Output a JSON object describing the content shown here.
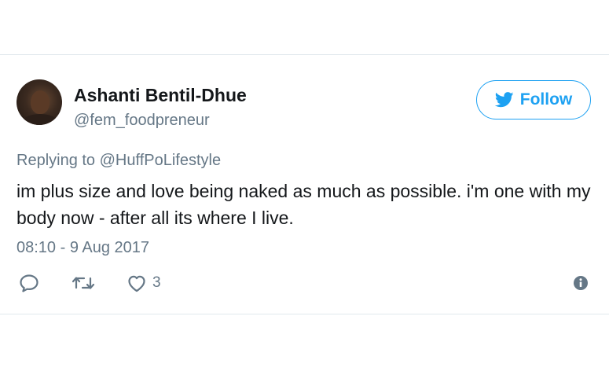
{
  "tweet": {
    "display_name": "Ashanti Bentil-Dhue",
    "handle": "@fem_foodpreneur",
    "replying_prefix": "Replying to",
    "replying_to": "@HuffPoLifestyle",
    "text": "im plus size and love being naked as much as possible. i'm one with my body now - after all its where I live.",
    "timestamp": "08:10 - 9 Aug 2017"
  },
  "follow_button": {
    "label": "Follow"
  },
  "actions": {
    "like_count": "3"
  },
  "icons": {
    "follow": "twitter-bird-icon",
    "reply": "reply-icon",
    "retweet": "retweet-icon",
    "like": "heart-icon",
    "info": "info-icon"
  },
  "colors": {
    "accent": "#1da1f2",
    "secondary_text": "#657786",
    "primary_text": "#14171a",
    "divider": "#e1e8ed"
  }
}
